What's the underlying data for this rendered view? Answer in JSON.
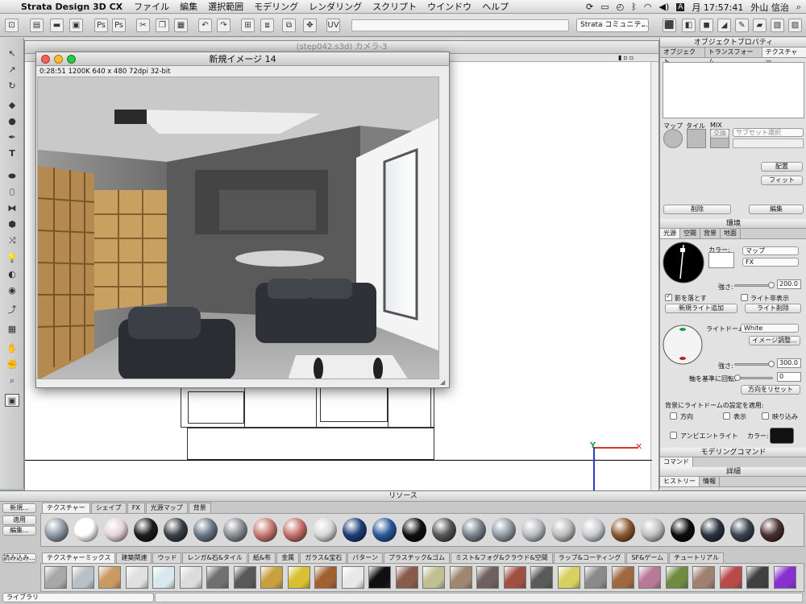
{
  "menubar": {
    "app_name": "Strata Design 3D CX",
    "menus": [
      "ファイル",
      "編集",
      "選択範囲",
      "モデリング",
      "レンダリング",
      "スクリプト",
      "ウインドウ",
      "ヘルプ"
    ],
    "clock": "月 17:57:41",
    "user": "外山 信治",
    "input_mode": "A"
  },
  "toolbar": {
    "community_select": "Strata コミュニテ..."
  },
  "camera_window": {
    "title": "(step042.s3d) カメラ-3"
  },
  "render_window": {
    "title": "新規イメージ 14",
    "info": "0:28:51   1200K   640 x 480   72dpi   32-bit"
  },
  "object_properties": {
    "title": "オブジェクトプロパティ",
    "tabs": [
      "オブジェクト",
      "トランスフォーム",
      "テクスチャー"
    ],
    "active_tab": 2,
    "map_label": "マップ",
    "tile_label": "タイル",
    "mix_label": "MIX",
    "exchange_btn": "交換",
    "subset_select": "サブセット選択",
    "place_btn": "配置",
    "fit_btn": "フィット",
    "delete_btn": "削除",
    "edit_btn": "編集"
  },
  "environment": {
    "title": "環境",
    "tabs": [
      "光源",
      "空間",
      "背景",
      "地面"
    ],
    "active_tab": 0,
    "color_label": "カラー:",
    "map_select": "マップ",
    "fx_select": "FX",
    "strength_label": "強さ:",
    "strength_value": "200.0",
    "strength_level": 1.0,
    "cast_shadow": "影を落とす",
    "cast_shadow_checked": true,
    "hide_light": "ライト非表示",
    "hide_light_checked": false,
    "add_light_btn": "新規ライト追加",
    "delete_light_btn": "ライト削除",
    "light_dome_label": "ライトドーム:",
    "light_dome_select": "White",
    "image_adjust_btn": "イメージ調整...",
    "dome_strength_label": "強さ:",
    "dome_strength_value": "300.0",
    "dome_strength_level": 1.0,
    "axis_rotate_label": "軸を基準に回転:",
    "axis_rotate_value": "0",
    "axis_rotate_level": 0.0,
    "direction_reset_btn": "方向をリセット",
    "apply_dome_label": "背景にライトドームの設定を適用:",
    "apply_direction": "方向",
    "apply_show": "表示",
    "apply_reflect": "映り込み",
    "ambient_label": "アンビエントライト",
    "ambient_color_label": "カラー:",
    "ambient_color": "#111111"
  },
  "modeling_commands": {
    "title": "モデリングコマンド",
    "tab": "コマンド"
  },
  "details": {
    "title": "詳細",
    "tabs": [
      "ヒストリー",
      "情報"
    ]
  },
  "resources": {
    "title": "リソース",
    "new_btn": "新規...",
    "apply_btn": "適用",
    "edit_btn": "編集...",
    "load_btn": "読み込み...",
    "library_select": "ライブラリ",
    "tabs": [
      "テクスチャー",
      "シェイプ",
      "FX",
      "光源マップ",
      "背景"
    ],
    "active_tab": 0,
    "categories": [
      "テクスチャーミックス",
      "建築関連",
      "ウッド",
      "レンガ&石&タイル",
      "紙&布",
      "金属",
      "ガラス&宝石",
      "パターン",
      "プラスチック&ゴム",
      "ミスト&フォグ&クラウド&空間",
      "ラップ&コーティング",
      "SF&ゲーム",
      "チュートリアル"
    ],
    "active_category": 0,
    "texture_swatches": [
      "#8e9aa6",
      "#ffffff",
      "#e8d4d8",
      "#1c1c1c",
      "#3a4048",
      "#6a7886",
      "#8a8e92",
      "#c87a72",
      "#c87068",
      "#d8d8d8",
      "#1f3e78",
      "#2a5a9a",
      "#101010",
      "#555555",
      "#78828c",
      "#909aa2",
      "#b8bcc0",
      "#bcbcbc",
      "#c8ccd0",
      "#8a5a30",
      "#c0c0c0",
      "#0c0c0c",
      "#2c3440",
      "#3a4450",
      "#4a3030"
    ],
    "mix_tiles": [
      "#a8a8a8",
      "#b8c0c8",
      "#c89a60",
      "#e0e0e0",
      "#d8e8f0",
      "#dcdcdc",
      "#707070",
      "#585858",
      "#c8a040",
      "#d8c030",
      "#a06030",
      "#e8e8e8",
      "#101010",
      "#8a5a4a",
      "#c0c090",
      "#a08870",
      "#706060",
      "#a05040",
      "#5a5a5a",
      "#d8d060",
      "#8a8a8a",
      "#a06840",
      "#b87898",
      "#708a40",
      "#a08070",
      "#b84a4a",
      "#404040",
      "#8830d0"
    ]
  }
}
